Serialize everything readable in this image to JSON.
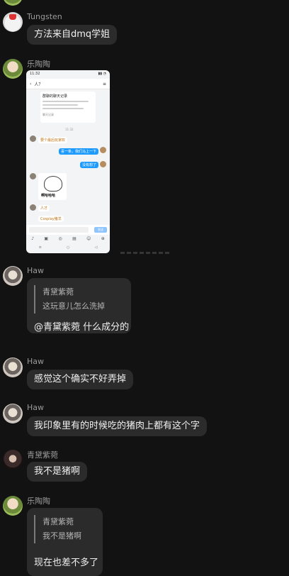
{
  "messages": [
    {
      "sender": "Tungsten",
      "text": "方法来自dmq学姐"
    },
    {
      "sender": "乐陶陶",
      "image": {
        "status_time": "11:32",
        "header_title": "人？",
        "card_title": "群聊的聊天记录",
        "card_tag": "聊天记录",
        "time": "11:32",
        "bubbles": [
          "要个最后玩家叹",
          "喜一条，我们马上一下",
          "没有想了",
          "人才",
          "Cosplay猪羊"
        ],
        "sticker_caption": "啊哈哈哈",
        "send_label": "发送"
      }
    },
    {
      "sender": "Haw",
      "quote_name": "青黛紫菀",
      "quote_text": "这玩意儿怎么洗掉",
      "text": "@青黛紫菀 什么成分的"
    },
    {
      "sender": "Haw",
      "text": "感觉这个确实不好弄掉"
    },
    {
      "sender": "Haw",
      "text": "我印象里有的时候吃的猪肉上都有这个字"
    },
    {
      "sender": "青黛紫菀",
      "text": "我不是猪啊"
    },
    {
      "sender": "乐陶陶",
      "quote_name": "青黛紫菀",
      "quote_text": "我不是猪啊",
      "text": "现在也差不多了"
    }
  ]
}
